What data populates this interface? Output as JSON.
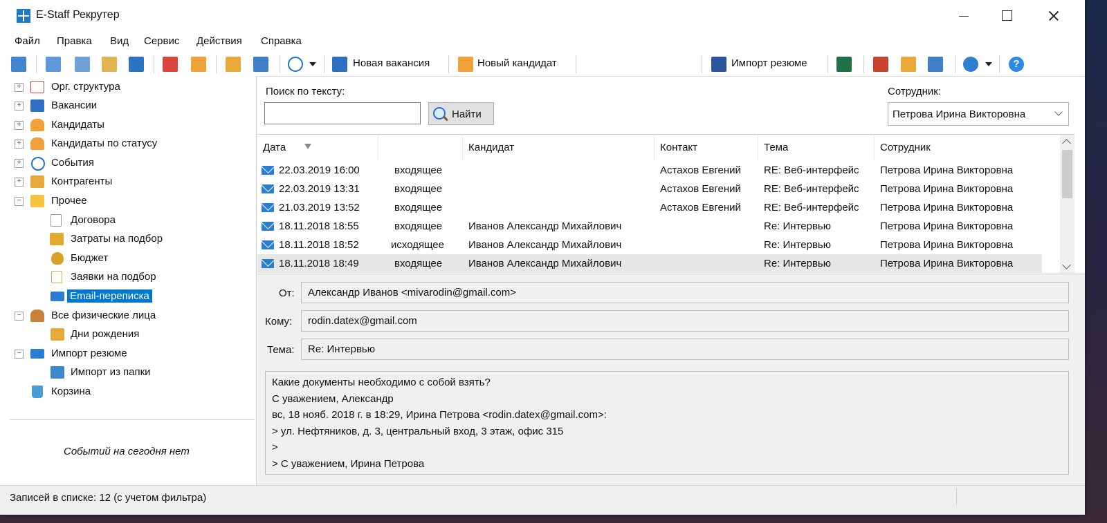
{
  "window": {
    "title": "E-Staff Рекрутер"
  },
  "menu": [
    "Файл",
    "Правка",
    "Вид",
    "Сервис",
    "Действия",
    "Справка"
  ],
  "toolbar": {
    "new_vacancy": "Новая вакансия",
    "new_candidate": "Новый кандидат",
    "import_resume": "Импорт резюме"
  },
  "tree": [
    {
      "label": "Орг. структура",
      "icon": "org-structure-icon"
    },
    {
      "label": "Вакансии",
      "icon": "vacancies-icon"
    },
    {
      "label": "Кандидаты",
      "icon": "candidates-icon"
    },
    {
      "label": "Кандидаты по статусу",
      "icon": "candidates-status-icon"
    },
    {
      "label": "События",
      "icon": "events-clock-icon"
    },
    {
      "label": "Контрагенты",
      "icon": "contractors-icon"
    },
    {
      "label": "Прочее",
      "icon": "folder-icon"
    },
    {
      "label": "Договора",
      "icon": "contract-icon"
    },
    {
      "label": "Затраты на подбор",
      "icon": "costs-icon"
    },
    {
      "label": "Бюджет",
      "icon": "budget-moneybag-icon"
    },
    {
      "label": "Заявки на подбор",
      "icon": "requests-checklist-icon"
    },
    {
      "label": "Email-переписка",
      "icon": "email-icon"
    },
    {
      "label": "Все физические лица",
      "icon": "persons-icon"
    },
    {
      "label": "Дни рождения",
      "icon": "gift-icon"
    },
    {
      "label": "Импорт резюме",
      "icon": "import-email-icon"
    },
    {
      "label": "Импорт из папки",
      "icon": "folder-blue-icon"
    },
    {
      "label": "Корзина",
      "icon": "recycle-bin-icon"
    }
  ],
  "no_events": "Событий на сегодня нет",
  "search": {
    "label": "Поиск по тексту:",
    "value": "",
    "button": "Найти"
  },
  "employee": {
    "label": "Сотрудник:",
    "value": "Петрова Ирина Викторовна"
  },
  "grid": {
    "columns": [
      "Дата",
      "",
      "Кандидат",
      "Контакт",
      "Тема",
      "Сотрудник"
    ],
    "rows": [
      {
        "date": "22.03.2019 16:00",
        "direction": "входящее",
        "candidate": "",
        "contact": "Астахов Евгений",
        "subject": "RE: Веб-интерфейс",
        "employee": "Петрова Ирина Викторовна"
      },
      {
        "date": "22.03.2019 13:31",
        "direction": "входящее",
        "candidate": "",
        "contact": "Астахов Евгений",
        "subject": "RE: Веб-интерфейс",
        "employee": "Петрова Ирина Викторовна"
      },
      {
        "date": "21.03.2019 13:52",
        "direction": "входящее",
        "candidate": "",
        "contact": "Астахов Евгений",
        "subject": "RE: Веб-интерфейс",
        "employee": "Петрова Ирина Викторовна"
      },
      {
        "date": "18.11.2018 18:55",
        "direction": "входящее",
        "candidate": "Иванов Александр Михайлович",
        "contact": "",
        "subject": "Re: Интервью",
        "employee": "Петрова Ирина Викторовна"
      },
      {
        "date": "18.11.2018 18:52",
        "direction": "исходящее",
        "candidate": "Иванов Александр Михайлович",
        "contact": "",
        "subject": "Re: Интервью",
        "employee": "Петрова Ирина Викторовна"
      },
      {
        "date": "18.11.2018 18:49",
        "direction": "входящее",
        "candidate": "Иванов Александр Михайлович",
        "contact": "",
        "subject": "Re: Интервью",
        "employee": "Петрова Ирина Викторовна"
      }
    ]
  },
  "detail": {
    "from_label": "От:",
    "from": "Александр Иванов <mivarodin@gmail.com>",
    "to_label": "Кому:",
    "to": "rodin.datex@gmail.com",
    "subject_label": "Тема:",
    "subject": "Re: Интервью",
    "body": [
      "Какие документы необходимо с собой взять?",
      "С уважением, Александр",
      "вс, 18 нояб. 2018 г. в 18:29, Ирина Петрова <rodin.datex@gmail.com>:",
      "> ул. Нефтяников, д. 3, центральный вход, 3 этаж, офис 315",
      ">",
      "> С уважением, Ирина Петрова"
    ]
  },
  "status": "Записей в списке: 12  (с учетом фильтра)"
}
